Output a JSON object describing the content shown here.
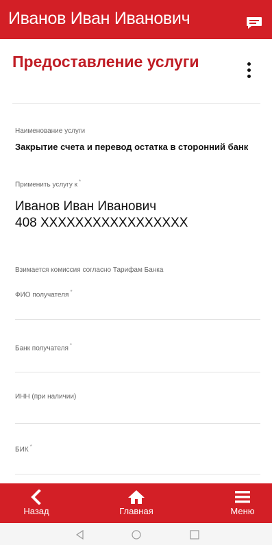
{
  "header": {
    "title": "Иванов Иван Иванович",
    "icon": "chat-icon"
  },
  "page": {
    "title": "Предоставление услуги",
    "menu_icon": "more-vertical-icon"
  },
  "service": {
    "name_label": "Наименование услуги",
    "name_value": "Закрытие счета и перевод остатка в сторонний банк",
    "apply_label": "Применить услугу к",
    "apply_required": "*",
    "client_name": "Иванов Иван Иванович",
    "account": "408 XXXXXXXXXXXXXXXXX",
    "commission_note": "Взимается комиссия согласно Тарифам Банка"
  },
  "fields": {
    "recipient_name": {
      "label": "ФИО получателя",
      "required": "*",
      "value": ""
    },
    "recipient_bank": {
      "label": "Банк получателя",
      "required": "*",
      "value": ""
    },
    "inn": {
      "label": "ИНН (при наличии)",
      "value": ""
    },
    "bik": {
      "label": "БИК",
      "required": "*",
      "value": ""
    }
  },
  "bottom_nav": {
    "back": {
      "label": "Назад",
      "icon": "chevron-left-icon"
    },
    "home": {
      "label": "Главная",
      "icon": "home-icon"
    },
    "menu": {
      "label": "Меню",
      "icon": "hamburger-icon"
    }
  },
  "colors": {
    "brand": "#d31f26",
    "title": "#c01d25"
  }
}
